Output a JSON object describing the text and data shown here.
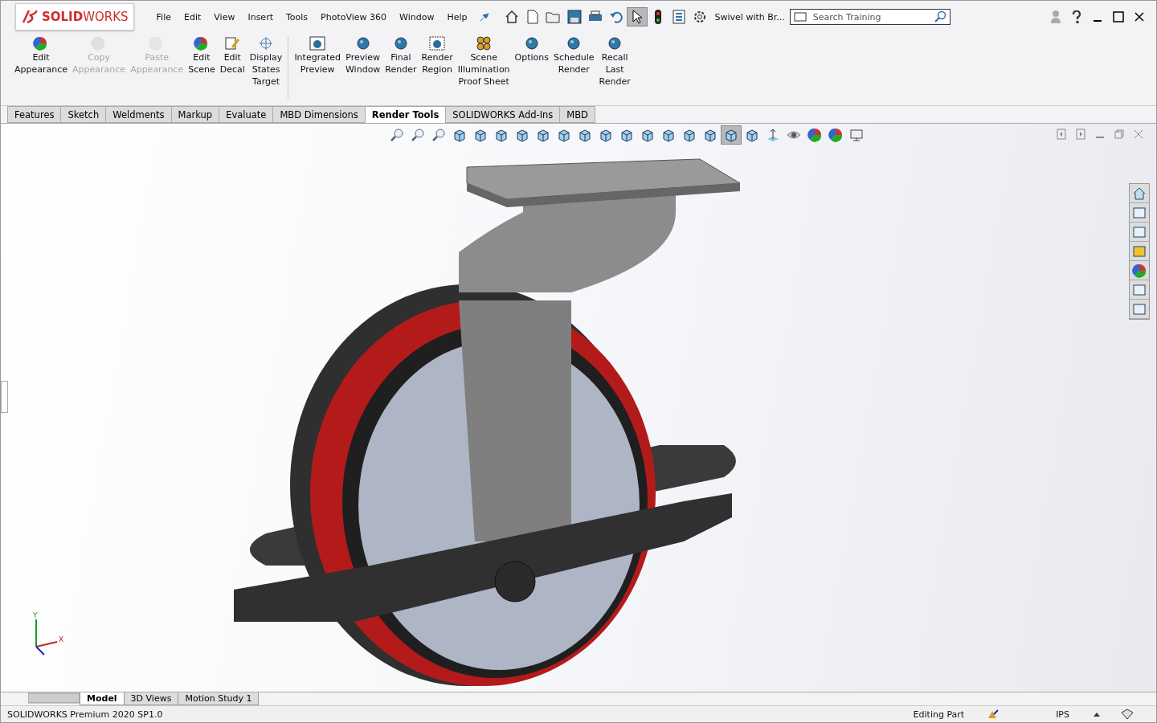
{
  "logo": {
    "text": "**SOLID**WORKS"
  },
  "menu": [
    "File",
    "Edit",
    "View",
    "Insert",
    "Tools",
    "PhotoView 360",
    "Window",
    "Help"
  ],
  "document_title": "Swivel with Br...",
  "search": {
    "placeholder": "Search Training"
  },
  "ribbon": [
    {
      "kind": "appearance",
      "lines": [
        "Edit",
        "Appearance"
      ],
      "disabled": false
    },
    {
      "kind": "copy",
      "lines": [
        "Copy",
        "Appearance"
      ],
      "disabled": true
    },
    {
      "kind": "paste",
      "lines": [
        "Paste",
        "Appearance"
      ],
      "disabled": true
    },
    {
      "kind": "scene",
      "lines": [
        "Edit",
        "Scene"
      ],
      "disabled": false
    },
    {
      "kind": "decal",
      "lines": [
        "Edit",
        "Decal"
      ],
      "disabled": false
    },
    {
      "kind": "target",
      "lines": [
        "Display",
        "States",
        "Target"
      ],
      "disabled": false
    },
    {
      "kind": "integrated",
      "lines": [
        "Integrated",
        "Preview"
      ],
      "disabled": false
    },
    {
      "kind": "preview",
      "lines": [
        "Preview",
        "Window"
      ],
      "disabled": false
    },
    {
      "kind": "final",
      "lines": [
        "Final",
        "Render"
      ],
      "disabled": false
    },
    {
      "kind": "region",
      "lines": [
        "Render",
        "Region"
      ],
      "disabled": false
    },
    {
      "kind": "proof",
      "lines": [
        "Scene",
        "Illumination",
        "Proof Sheet"
      ],
      "disabled": false
    },
    {
      "kind": "options",
      "lines": [
        "Options"
      ],
      "disabled": false
    },
    {
      "kind": "schedule",
      "lines": [
        "Schedule",
        "Render"
      ],
      "disabled": false
    },
    {
      "kind": "recall",
      "lines": [
        "Recall",
        "Last",
        "Render"
      ],
      "disabled": false
    }
  ],
  "command_tabs": [
    {
      "label": "Features",
      "selected": false
    },
    {
      "label": "Sketch",
      "selected": false
    },
    {
      "label": "Weldments",
      "selected": false
    },
    {
      "label": "Markup",
      "selected": false
    },
    {
      "label": "Evaluate",
      "selected": false
    },
    {
      "label": "MBD Dimensions",
      "selected": false
    },
    {
      "label": "Render Tools",
      "selected": true
    },
    {
      "label": "SOLIDWORKS Add-Ins",
      "selected": false
    },
    {
      "label": "MBD",
      "selected": false
    }
  ],
  "view_tools": [
    {
      "kind": "zoom",
      "selected": false
    },
    {
      "kind": "zoom",
      "selected": false
    },
    {
      "kind": "zoom",
      "selected": false
    },
    {
      "kind": "cube",
      "selected": false
    },
    {
      "kind": "cube",
      "selected": false
    },
    {
      "kind": "cube",
      "selected": false
    },
    {
      "kind": "cube",
      "selected": false
    },
    {
      "kind": "cube",
      "selected": false
    },
    {
      "kind": "cube",
      "selected": false
    },
    {
      "kind": "cube",
      "selected": false
    },
    {
      "kind": "cube",
      "selected": false
    },
    {
      "kind": "cube",
      "selected": false
    },
    {
      "kind": "cube",
      "selected": false
    },
    {
      "kind": "cube",
      "selected": false
    },
    {
      "kind": "cube",
      "selected": false
    },
    {
      "kind": "cube",
      "selected": false
    },
    {
      "kind": "cube",
      "selected": true
    },
    {
      "kind": "cube",
      "selected": false
    },
    {
      "kind": "plane",
      "selected": false
    },
    {
      "kind": "eye",
      "selected": false
    },
    {
      "kind": "sphere",
      "selected": false
    },
    {
      "kind": "sphere",
      "selected": false
    },
    {
      "kind": "monitor",
      "selected": false
    }
  ],
  "triad": {
    "y_label": "Y",
    "x_label": "X"
  },
  "bottom_tabs": [
    {
      "label": "Model",
      "selected": true
    },
    {
      "label": "3D Views",
      "selected": false
    },
    {
      "label": "Motion Study 1",
      "selected": false
    }
  ],
  "status_bar": {
    "product": "SOLIDWORKS Premium 2020 SP1.0",
    "mode": "Editing Part",
    "units": "IPS"
  }
}
